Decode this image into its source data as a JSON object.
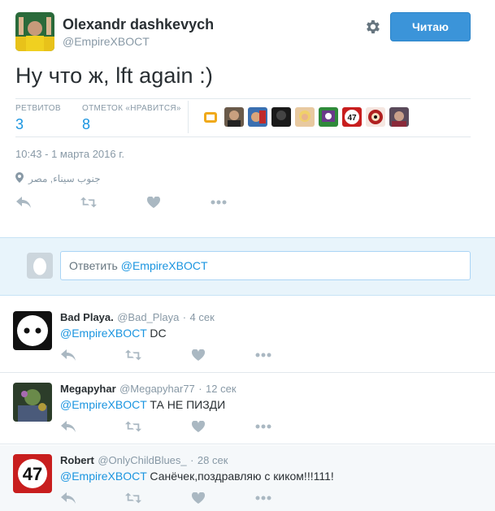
{
  "author": {
    "name": "Olexandr dashkevych",
    "handle": "@EmpireXBOCT",
    "follow_label": "Читаю"
  },
  "tweet": {
    "text": "Ну что ж, lft again :)",
    "timestamp": "10:43 - 1 марта 2016 г.",
    "location": "جنوب سيناء, مصر"
  },
  "stats": {
    "retweets_label": "РЕТВИТОВ",
    "retweets_count": "3",
    "likes_label": "ОТМЕТОК «НРАВИТСЯ»",
    "likes_count": "8"
  },
  "reply_box": {
    "prefix": "Ответить",
    "mention": "@EmpireXBOCT"
  },
  "replies": [
    {
      "name": "Bad Playa.",
      "handle": "@Bad_Playa",
      "time": "4 сек",
      "mention": "@EmpireXBOCT",
      "text": "DC"
    },
    {
      "name": "Megapyhar",
      "handle": "@Megapyhar77",
      "time": "12 сек",
      "mention": "@EmpireXBOCT",
      "text": "ТА НЕ ПИЗДИ"
    },
    {
      "name": "Robert",
      "handle": "@OnlyChildBlues_",
      "time": "28 сек",
      "mention": "@EmpireXBOCT",
      "text": "Санёчек,поздравляю с киком!!!111!"
    }
  ],
  "separator": "·",
  "colors": {
    "link": "#1b95e0",
    "follow_button": "#3b94d9",
    "muted": "#8899a6"
  }
}
